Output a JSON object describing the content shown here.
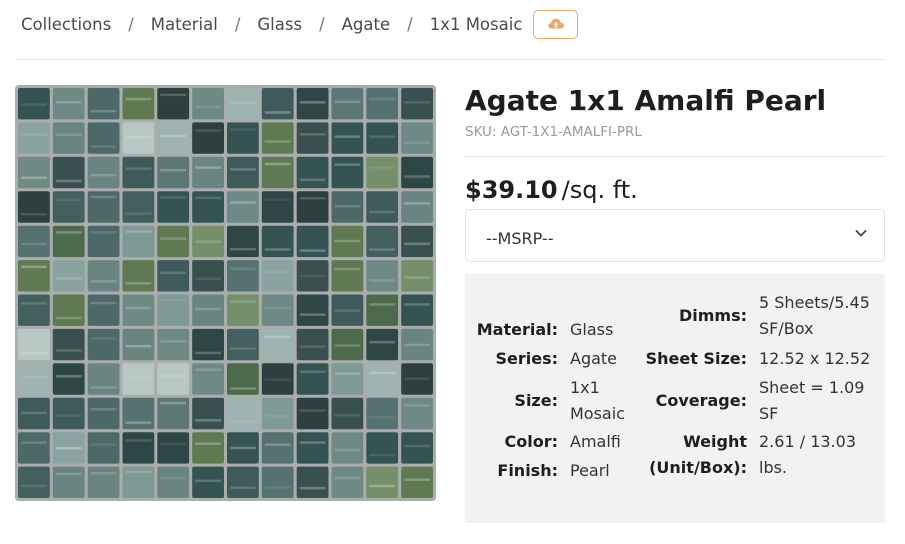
{
  "breadcrumb": {
    "items": [
      "Collections",
      "Material",
      "Glass",
      "Agate",
      "1x1 Mosaic"
    ],
    "separator": "/",
    "cloud_icon": "cloud-upload-icon"
  },
  "product": {
    "title": "Agate 1x1 Amalfi Pearl",
    "sku": "SKU: AGT-1X1-AMALFI-PRL",
    "price": "$39.10",
    "price_unit": "/sq. ft.",
    "msrp_select": "--MSRP--"
  },
  "specs": {
    "left": [
      {
        "label": "Material:",
        "value": "Glass"
      },
      {
        "label": "Series:",
        "value": "Agate"
      },
      {
        "label": "Size:",
        "value": "1x1 Mosaic"
      },
      {
        "label": "Color:",
        "value": "Amalfi"
      },
      {
        "label": "Finish:",
        "value": "Pearl"
      }
    ],
    "right": [
      {
        "label": "Dimms:",
        "value": "5 Sheets/5.45 SF/Box"
      },
      {
        "label": "Sheet Size:",
        "value": "12.52 x 12.52"
      },
      {
        "label": "Coverage:",
        "value": "Sheet = 1.09 SF"
      },
      {
        "label": "Weight (Unit/Box):",
        "value": "2.61 / 13.03 lbs."
      }
    ]
  },
  "colors": {
    "accent": "#e8a96a",
    "grout": "#a9aeac"
  }
}
